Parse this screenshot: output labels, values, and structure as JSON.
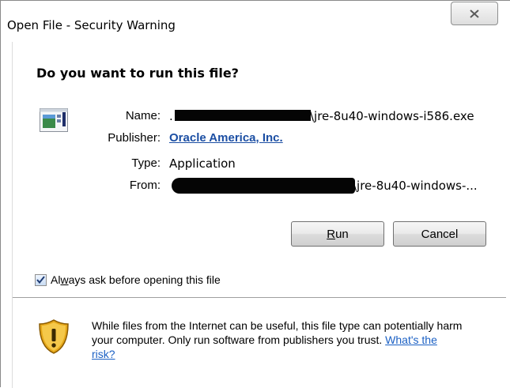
{
  "window": {
    "title": "Open File - Security Warning",
    "close_icon": "close-icon"
  },
  "dialog": {
    "question": "Do you want to run this file?",
    "file_icon": "executable-file-icon",
    "fields": {
      "name_label": "Name:",
      "name_value_prefix": ".",
      "name_value_suffix": "\\jre-8u40-windows-i586.exe",
      "publisher_label": "Publisher:",
      "publisher_value": "Oracle America, Inc.",
      "type_label": "Type:",
      "type_value": "Application",
      "from_label": "From:",
      "from_value_suffix": "\\jre-8u40-windows-..."
    },
    "buttons": {
      "run_accel": "R",
      "run_rest": "un",
      "cancel": "Cancel"
    },
    "checkbox": {
      "checked": true,
      "label_pre": "Al",
      "label_accel": "w",
      "label_post": "ays ask before opening this file"
    },
    "warning": {
      "icon": "shield-warning-icon",
      "text": "While files from the Internet can be useful, this file type can potentially harm your computer. Only run software from publishers you trust.",
      "link": "What's the risk?"
    }
  },
  "colors": {
    "link": "#1b4ea3",
    "redaction": "#050505"
  }
}
